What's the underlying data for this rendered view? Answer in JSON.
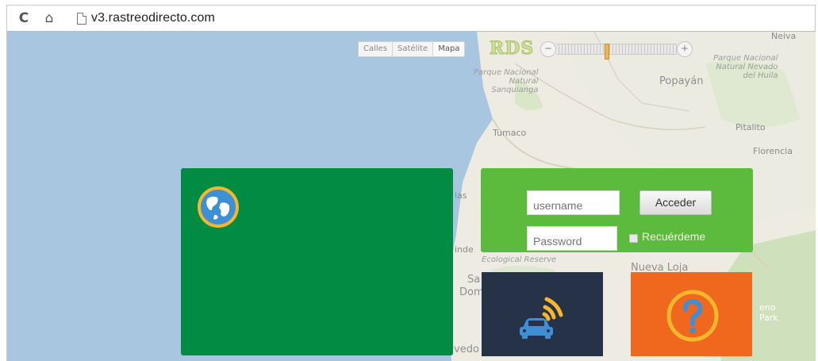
{
  "browser": {
    "url": "v3.rastreodirecto.com",
    "reload_icon": "reload-icon",
    "home_icon": "home-icon",
    "page_icon": "page-icon"
  },
  "map": {
    "type_buttons": [
      "Calles",
      "Satélite",
      "Mapa"
    ],
    "brand": "RDS",
    "zoom_out_label": "−",
    "zoom_in_label": "+",
    "zoom_level": 0.42,
    "places": {
      "neiva": "Neiva",
      "pn_sanquianga": "Parque Nacional\nNatural\nSanquianga",
      "popayan": "Popayán",
      "pn_huila": "Parque Nacional\nNatural Nevado\ndel Huila",
      "tumaco": "Tumaco",
      "pitalito": "Pitalito",
      "florencia": "Florencia",
      "las_fragment": "las",
      "inde_fragment": "inde",
      "eco_reserve": "Ecological Reserve",
      "nueva_loja": "Nueva Loja",
      "sa_fragment": "Sa",
      "dom_fragment": "Dom",
      "vedo_fragment": "vedo",
      "eno_fragment": "eno",
      "park_fragment": "Park"
    }
  },
  "login": {
    "username_placeholder": "username",
    "password_placeholder": "Password",
    "submit_label": "Acceder",
    "remember_label": "Recuérdeme"
  },
  "colors": {
    "welcome_green": "#028c43",
    "login_green": "#5cbb3c",
    "tracking_navy": "#253248",
    "help_orange": "#f0681e",
    "icon_yellow": "#f6b72d",
    "icon_blue": "#3d8fd6"
  },
  "icons": {
    "globe": "globe-icon",
    "tracking": "car-signal-icon",
    "help": "question-mark-icon"
  }
}
